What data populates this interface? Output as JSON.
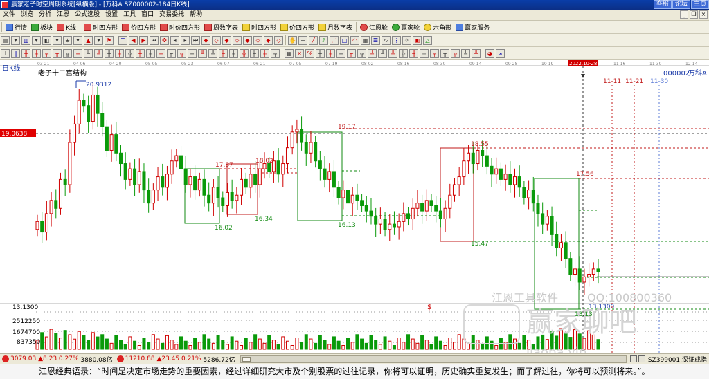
{
  "window": {
    "title": "赢家老子时空周期系统[纵横版] - [万科A  SZ000002-184日K线]",
    "links": [
      "客服",
      "论坛",
      "主页"
    ]
  },
  "menu": {
    "items": [
      "文件",
      "浏览",
      "分析",
      "江恩",
      "公式选股",
      "设置",
      "工具",
      "窗口",
      "交易委托",
      "帮助"
    ]
  },
  "toolbar1": {
    "items": [
      {
        "label": "行情",
        "icon": "quote-icon"
      },
      {
        "label": "板块",
        "icon": "sector-icon"
      },
      {
        "label": "K线",
        "icon": "kline-icon"
      },
      {
        "label": "时四方形",
        "icon": "time-square-icon"
      },
      {
        "label": "价四方形",
        "icon": "price-square-icon"
      },
      {
        "label": "时价四方形",
        "icon": "time-price-square-icon"
      },
      {
        "label": "周数字表",
        "icon": "week-number-icon"
      },
      {
        "label": "时四方形",
        "icon": "time-square-icon"
      },
      {
        "label": "价四方形",
        "icon": "price-square-icon"
      },
      {
        "label": "月数字表",
        "icon": "month-number-icon"
      },
      {
        "label": "江恩轮",
        "icon": "gann-wheel-icon"
      },
      {
        "label": "赢家轮",
        "icon": "winner-wheel-icon"
      },
      {
        "label": "六角形",
        "icon": "hexagon-icon"
      },
      {
        "label": "赢家服务",
        "icon": "service-icon"
      }
    ]
  },
  "chart": {
    "period_label": "日K线",
    "structure_label": "老子十二宫结构",
    "code_label": "000002",
    "name_label": "万科A",
    "current_price_tag": "19.0638",
    "volume_ticks": [
      "2512250",
      "1674700",
      "837350"
    ],
    "volume_top_label": "13.1300",
    "date_ticks": [
      "03-21",
      "04-06",
      "04-20",
      "05-05",
      "05-23",
      "06-07",
      "06-21",
      "07-05",
      "07-19",
      "08-02",
      "08-16",
      "08-30",
      "09-14",
      "09-28",
      "10-19",
      "2022.10-28",
      "11-16",
      "11-30",
      "12-14"
    ],
    "future_dates": [
      "11-11",
      "11-21",
      "11-30"
    ],
    "price_annotations": [
      "20.9312",
      "17.87",
      "18.02",
      "16.02",
      "16.34",
      "19.17",
      "16.13",
      "18.55",
      "15.47",
      "17.56",
      "13.13",
      "13.1300"
    ],
    "watermark_text": "江恩工具软件",
    "watermark_phone": "QQ:100800360",
    "logo_text": "赢家聊吧",
    "logo_url": "jiaoba.vip",
    "colors": {
      "up": "#d00000",
      "down": "#0a9a0a",
      "box_red": "#c01818",
      "box_green": "#108a10",
      "accent_blue": "#1a3aa8"
    }
  },
  "statusbar": {
    "sh_index": "3079.03",
    "sh_change": "▲8.23 0.27%",
    "sh_amount": "3880.08亿",
    "sz_index": "11210.88",
    "sz_change": "▲23.45 0.21%",
    "sz_amount": "5286.72亿",
    "right_code": "SZ399001,深证成指"
  },
  "quote": "江恩经典语录：“时间是决定市场走势的重要因素，经过详细研究大市及个别股票的过往记录，你将可以证明，历史确实重复发生；而了解过往，你将可以预测将来。”。"
}
